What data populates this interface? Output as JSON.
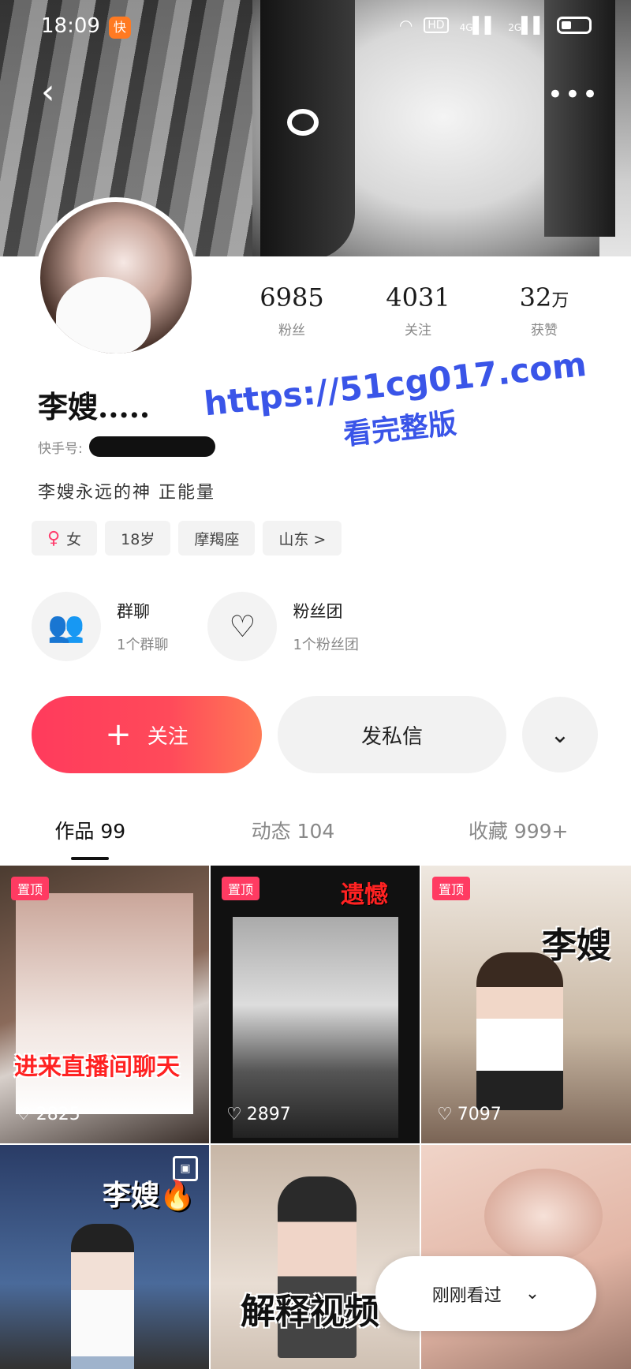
{
  "status_bar": {
    "time": "18:09",
    "app_badge": "快",
    "hd": "HD",
    "net1": "4G",
    "net2": "2G"
  },
  "header": {
    "back": "‹",
    "more": "•••"
  },
  "stats": [
    {
      "value": "6985",
      "label": "粉丝"
    },
    {
      "value": "4031",
      "label": "关注"
    },
    {
      "value": "32",
      "unit": "万",
      "label": "获赞"
    }
  ],
  "profile": {
    "name": "李嫂.....",
    "kuaishou_id_label": "快手号:",
    "bio": "李嫂永远的神 正能量"
  },
  "tags": {
    "gender": "女",
    "age": "18岁",
    "zodiac": "摩羯座",
    "location": "山东 >"
  },
  "groups": [
    {
      "title": "群聊",
      "sub": "1个群聊"
    },
    {
      "title": "粉丝团",
      "sub": "1个粉丝团"
    }
  ],
  "actions": {
    "follow": "关注",
    "plus": "+",
    "message": "发私信",
    "more": "⌄"
  },
  "tabs": [
    {
      "label": "作品 99"
    },
    {
      "label": "动态 104"
    },
    {
      "label": "收藏 999+"
    }
  ],
  "videos": [
    {
      "pin": "置顶",
      "likes": "2825",
      "caption": "进来直播间聊天"
    },
    {
      "pin": "置顶",
      "likes": "2897",
      "caption": "遗憾"
    },
    {
      "pin": "置顶",
      "likes": "7097",
      "caption": "李嫂"
    },
    {
      "caption": "李嫂🔥"
    },
    {
      "caption": "解释视频"
    },
    {
      "caption": ""
    }
  ],
  "recently_watched": {
    "label": "刚刚看过",
    "icon": "⌄"
  },
  "watermark": {
    "line1": "https://51cg017.com",
    "line2": "看完整版"
  }
}
